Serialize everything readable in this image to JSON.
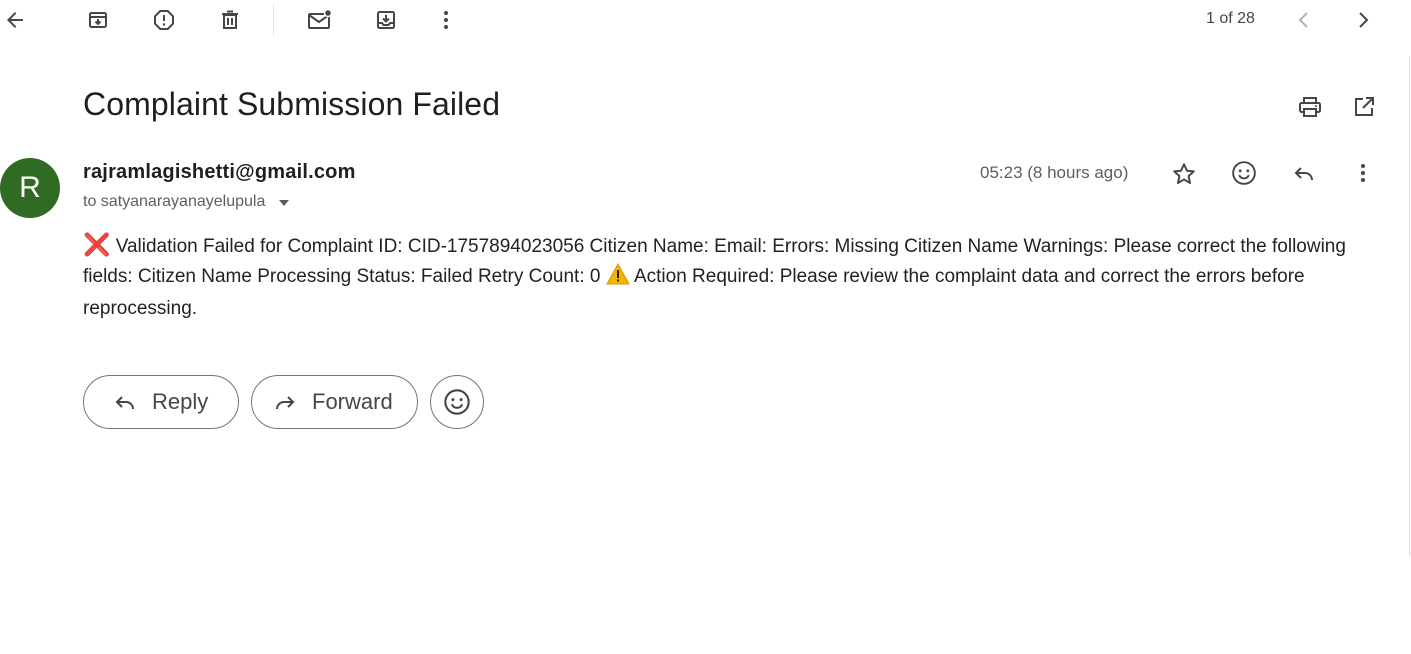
{
  "toolbar": {
    "icons": [
      "back-arrow-icon",
      "archive-icon",
      "report-spam-icon",
      "delete-icon",
      "mark-unread-icon",
      "move-to-icon",
      "more-vert-icon"
    ],
    "page_count": "1 of 28"
  },
  "email": {
    "subject": "Complaint Submission Failed",
    "avatar_letter": "R",
    "avatar_color": "#2f6b22",
    "sender": "rajramlagishetti@gmail.com",
    "recipient": "to satyanarayanayelupula",
    "timestamp": "05:23 (8 hours ago)",
    "body_part1": "Validation Failed for Complaint ID: CID-1757894023056 Citizen Name: Email: Errors: Missing Citizen Name Warnings: Please correct the following fields: Citizen Name Processing Status: Failed Retry Count: 0",
    "body_part2": "Action Required: Please review the complaint data and correct the errors before reprocessing.",
    "emoji_x": "❌",
    "emoji_warn": "warning-icon"
  },
  "actions": {
    "reply_label": "Reply",
    "forward_label": "Forward"
  }
}
